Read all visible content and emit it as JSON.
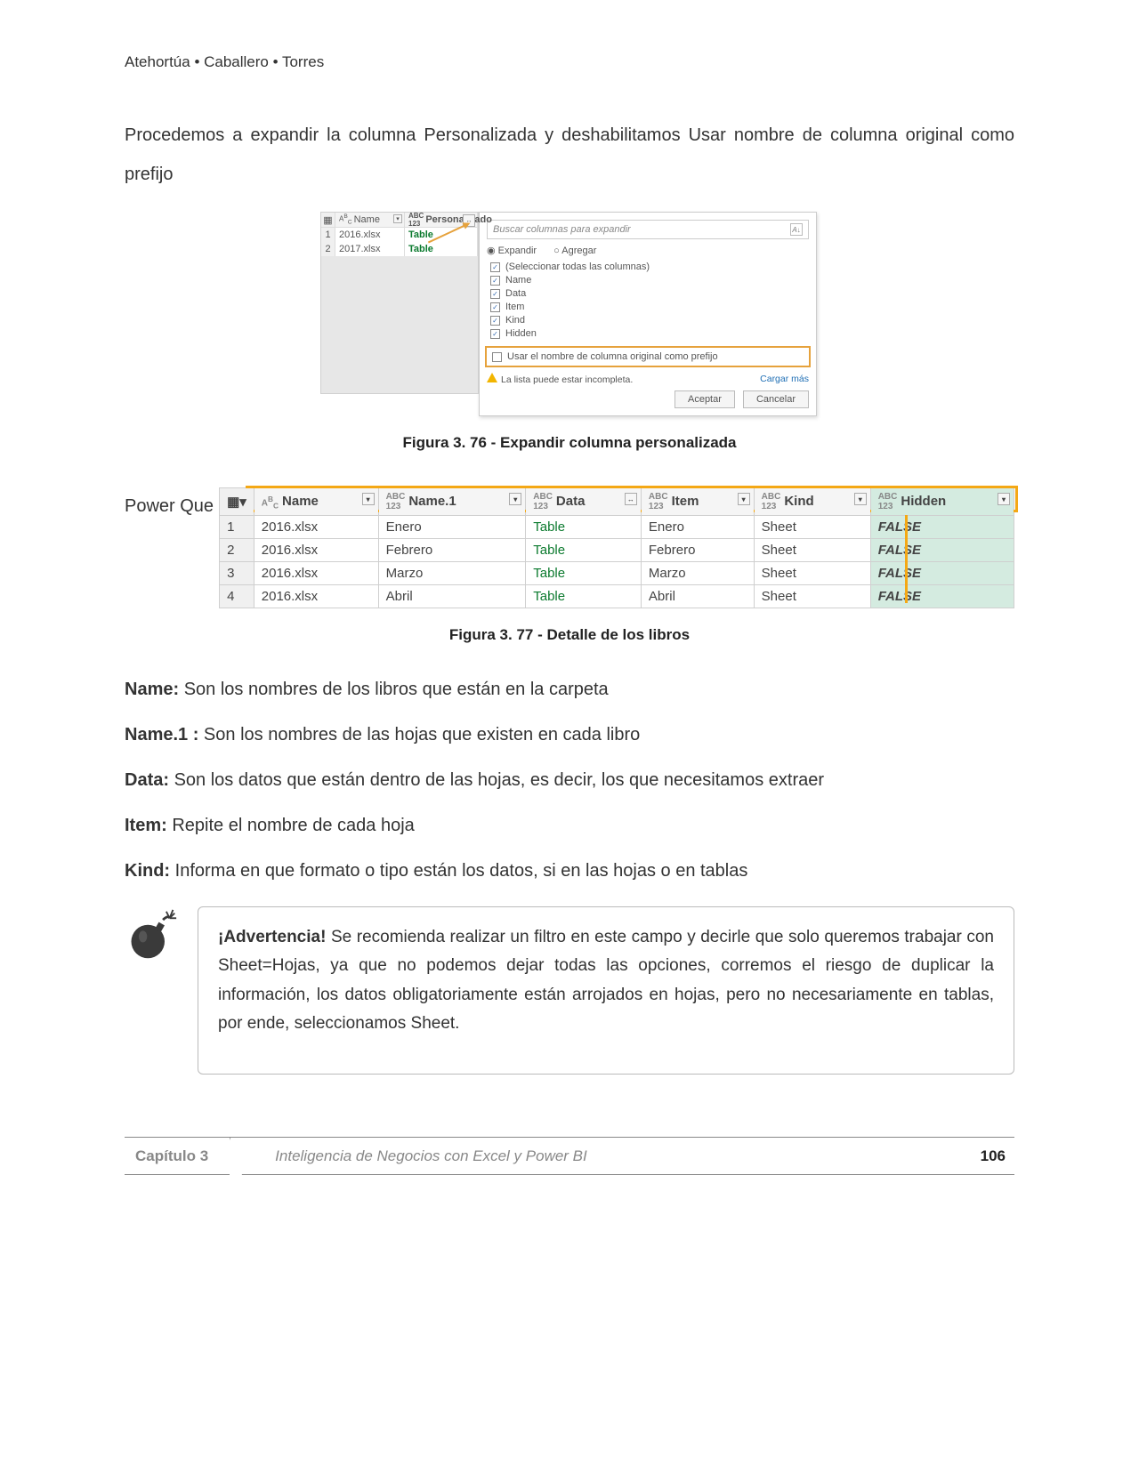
{
  "header": {
    "authors": "Atehortúa • Caballero • Torres"
  },
  "intro": "Procedemos a expandir la columna Personalizada y deshabilitamos Usar nombre de columna original como prefijo",
  "fig76": {
    "grid": {
      "col_name": "Name",
      "col_pers": "Personalizado",
      "rows": [
        {
          "idx": "1",
          "name": "2016.xlsx",
          "pers": "Table"
        },
        {
          "idx": "2",
          "name": "2017.xlsx",
          "pers": "Table"
        }
      ]
    },
    "popup": {
      "search_placeholder": "Buscar columnas para expandir",
      "radio_expand": "Expandir",
      "radio_add": "Agregar",
      "select_all": "(Seleccionar todas las columnas)",
      "options": [
        "Name",
        "Data",
        "Item",
        "Kind",
        "Hidden"
      ],
      "prefix_label": "Usar el nombre de columna original como prefijo",
      "warn_text": "La lista puede estar incompleta.",
      "load_more": "Cargar más",
      "btn_ok": "Aceptar",
      "btn_cancel": "Cancelar"
    },
    "caption": "Figura 3. 76 - Expandir columna personalizada"
  },
  "fig77": {
    "lead": "Power Que",
    "columns": [
      "Name",
      "Name.1",
      "Data",
      "Item",
      "Kind",
      "Hidden"
    ],
    "rows": [
      {
        "idx": "1",
        "c": [
          "2016.xlsx",
          "Enero",
          "Table",
          "Enero",
          "Sheet",
          "FALSE"
        ]
      },
      {
        "idx": "2",
        "c": [
          "2016.xlsx",
          "Febrero",
          "Table",
          "Febrero",
          "Sheet",
          "FALSE"
        ]
      },
      {
        "idx": "3",
        "c": [
          "2016.xlsx",
          "Marzo",
          "Table",
          "Marzo",
          "Sheet",
          "FALSE"
        ]
      },
      {
        "idx": "4",
        "c": [
          "2016.xlsx",
          "Abril",
          "Table",
          "Abril",
          "Sheet",
          "FALSE"
        ]
      }
    ],
    "caption": "Figura 3. 77 - Detalle de los libros"
  },
  "descriptions": {
    "name_l": "Name:",
    "name_t": " Son los nombres de los libros que están en la carpeta",
    "name1_l": "Name.1 :",
    "name1_t": " Son los nombres de las hojas que existen en cada libro",
    "data_l": "Data:",
    "data_t": " Son los datos que están dentro de las hojas, es decir, los que necesitamos extraer",
    "item_l": "Item:",
    "item_t": " Repite el nombre de cada hoja",
    "kind_l": "Kind:",
    "kind_t": " Informa en que formato o tipo están los datos, si en las hojas o en tablas"
  },
  "warning": {
    "label": "¡Advertencia!",
    "text": " Se recomienda realizar un filtro en este campo y decirle que solo queremos trabajar con Sheet=Hojas, ya que no podemos dejar todas las opciones, corremos el riesgo de duplicar la información, los datos obligatoriamente están arrojados en hojas, pero no necesariamente en tablas, por ende, seleccionamos Sheet."
  },
  "footer": {
    "chapter": "Capítulo 3",
    "title": "Inteligencia de Negocios con Excel y Power BI",
    "page": "106"
  }
}
